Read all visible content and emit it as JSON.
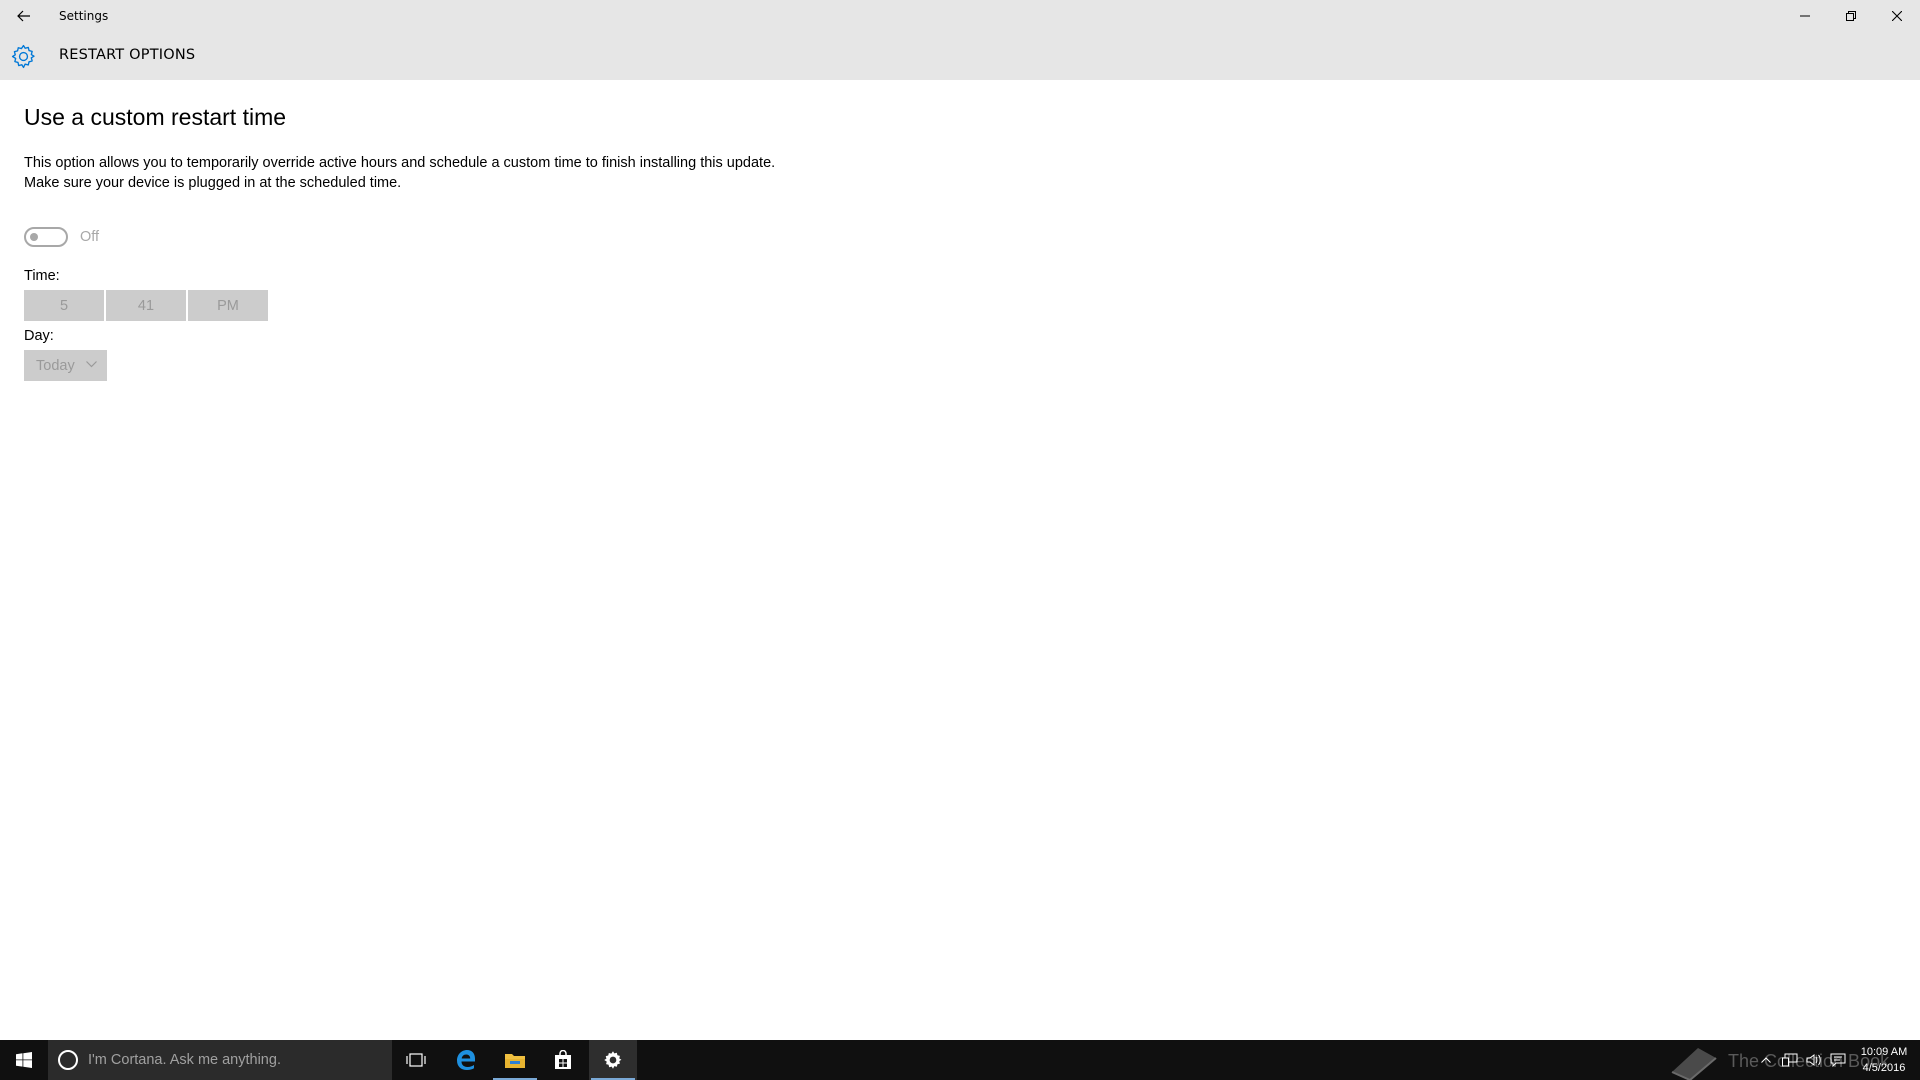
{
  "window": {
    "title": "Settings",
    "controls": [
      "minimize-icon",
      "restore-icon",
      "close-icon"
    ]
  },
  "header": {
    "icon": "gear-icon",
    "title": "RESTART OPTIONS"
  },
  "main": {
    "heading": "Use a custom restart time",
    "description_line1": "This option allows you to temporarily override active hours and schedule a custom time to finish installing this update.",
    "description_line2": "Make sure your device is plugged in at the scheduled time.",
    "toggle": {
      "state": "Off",
      "on": false
    },
    "time_label": "Time:",
    "time": {
      "hour": "5",
      "minute": "41",
      "period": "PM"
    },
    "day_label": "Day:",
    "day": {
      "selected": "Today"
    }
  },
  "taskbar": {
    "search_placeholder": "I'm Cortana. Ask me anything.",
    "pinned": [
      "task-view-icon",
      "edge-icon",
      "file-explorer-icon",
      "store-icon",
      "settings-icon"
    ],
    "active": "settings-icon",
    "watermark": "The Collection Book",
    "clock_time": "10:09 AM",
    "clock_date": "4/5/2016"
  },
  "colors": {
    "titlebar_bg": "#e6e6e6",
    "accent": "#0078d7",
    "disabled_text": "#9a9a9a",
    "disabled_bg": "#cccccc",
    "taskbar_bg": "#101010"
  }
}
